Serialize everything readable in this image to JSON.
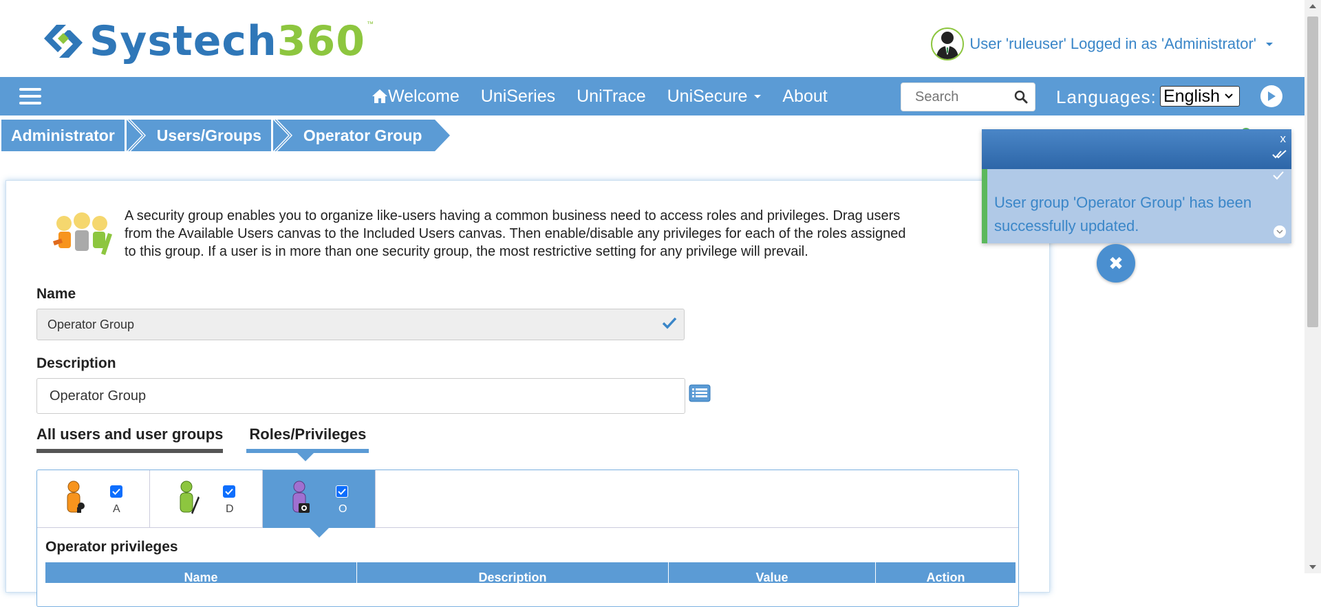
{
  "header": {
    "logo_primary": "Systech",
    "logo_secondary": "360",
    "logo_tm": "™",
    "user_text": "User 'ruleuser' Logged in as 'Administrator'"
  },
  "nav": {
    "items": [
      {
        "label": "Welcome",
        "icon": "home-icon"
      },
      {
        "label": "UniSeries"
      },
      {
        "label": "UniTrace"
      },
      {
        "label": "UniSecure",
        "dropdown": true
      },
      {
        "label": "About"
      }
    ],
    "search_placeholder": "Search",
    "languages_label": "Languages:",
    "language_selected": "English"
  },
  "breadcrumb": {
    "items": [
      "Administrator",
      "Users/Groups",
      "Operator Group"
    ]
  },
  "main": {
    "intro_lines": [
      "A security group enables you to organize like-users having a common business need to access roles and privileges. Drag users",
      "from the Available Users canvas to the Included Users canvas. Then enable/disable any privileges for each of the roles assigned",
      "to this group. If a user is in more than one security group, the most restrictive setting for any privilege will prevail."
    ],
    "name_label": "Name",
    "name_value": "Operator Group",
    "description_label": "Description",
    "description_value": "Operator Group",
    "tabs": [
      "All users and user groups",
      "Roles/Privileges"
    ],
    "roles": [
      {
        "letter": "A",
        "checked": true,
        "color": "#f7941d"
      },
      {
        "letter": "D",
        "checked": true,
        "color": "#8dc63f"
      },
      {
        "letter": "O",
        "checked": true,
        "color": "#a070d0",
        "active": true
      }
    ],
    "privileges_title": "Operator privileges",
    "table_headers": [
      "Name",
      "Description",
      "Value",
      "Action"
    ]
  },
  "toast": {
    "close": "x",
    "message": "User group 'Operator Group' has been successfully updated."
  },
  "colors": {
    "accent": "#5b9bd5",
    "brand_blue": "#2f77b8",
    "brand_green": "#8dc63f",
    "success": "#5cb85c"
  }
}
